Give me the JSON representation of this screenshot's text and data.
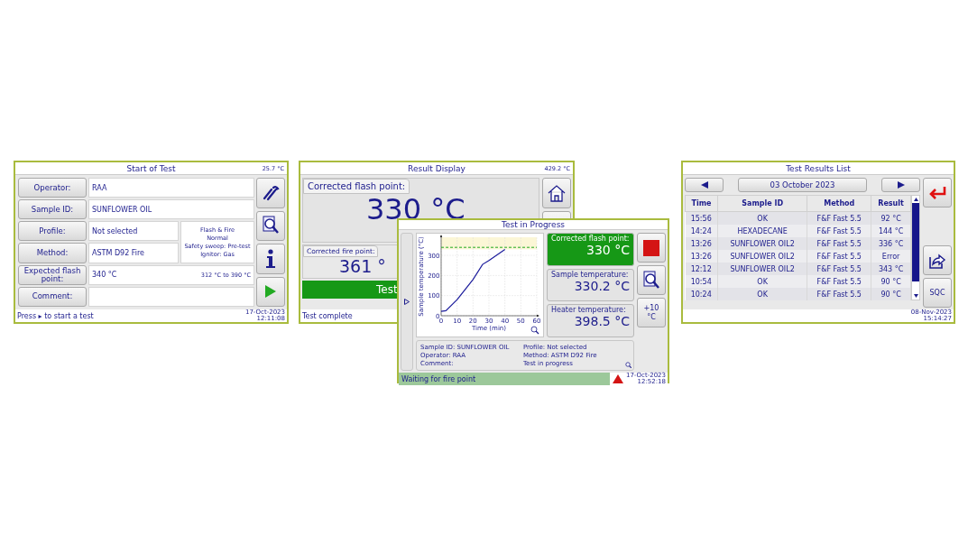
{
  "start_of_test": {
    "title": "Start of Test",
    "temperature": "25.7 °C",
    "fields": [
      {
        "label": "Operator:",
        "value": "RAA",
        "kind": "wide"
      },
      {
        "label": "Sample ID:",
        "value": "SUNFLOWER OIL",
        "kind": "wide"
      },
      {
        "label": "Profile:",
        "value": "Not selected",
        "kind": "narrow"
      },
      {
        "label": "Method:",
        "value": "ASTM D92 Fire",
        "kind": "narrow"
      },
      {
        "label": "Expected flash point:",
        "value": "340 °C",
        "range": "312 °C to 390 °C",
        "kind": "wide"
      },
      {
        "label": "Comment:",
        "kind": "wide"
      }
    ],
    "settings": [
      "Flash & Fire",
      "Normal",
      "Safety sweep: Pre-test",
      "Ignitor: Gas"
    ],
    "status": "Press ▸ to start a test",
    "date": "17-Oct-2023",
    "time": "12:11:08"
  },
  "result_display": {
    "title": "Result Display",
    "temperature": "429.2 °C",
    "flash_label": "Corrected flash point:",
    "flash_value": "330 °C",
    "fire_label": "Corrected fire point:",
    "fire_value": "361 °",
    "banner": "Test",
    "status": "Test complete"
  },
  "test_in_progress": {
    "title": "Test in Progress",
    "chart_data": {
      "type": "line",
      "xlabel": "Time (min)",
      "ylabel": "Sample temperature (°C)",
      "x": [
        0,
        3,
        10,
        20,
        26,
        30,
        40,
        60
      ],
      "series": [
        {
          "color": "#1c1c9c",
          "values": [
            22,
            25,
            80,
            180,
            255,
            275,
            330,
            null
          ]
        },
        {
          "color": "#22aa22",
          "line_style": "dashed",
          "values": [
            340,
            340,
            340,
            340,
            340,
            340,
            340,
            340
          ]
        }
      ],
      "xlim": [
        0,
        60
      ],
      "ylim": [
        0,
        390
      ],
      "xticks": [
        0,
        10,
        20,
        30,
        40,
        50,
        60
      ],
      "yticks": [
        0,
        100,
        200,
        300
      ],
      "grid": true,
      "bands": [
        {
          "from": 330,
          "to": 390,
          "axis": "y",
          "color": "#fbf6d6"
        }
      ]
    },
    "readings": [
      {
        "label": "Corrected flash point:",
        "value": "330 °C",
        "active": true
      },
      {
        "label": "Sample temperature:",
        "value": "330.2 °C",
        "active": false
      },
      {
        "label": "Heater temperature:",
        "value": "398.5 °C",
        "active": false
      }
    ],
    "offset_button": "+10 °C",
    "info_left": [
      "Sample ID: SUNFLOWER OIL",
      "Operator: RAA",
      "Comment:"
    ],
    "info_right": [
      "Profile: Not selected",
      "Method: ASTM D92 Fire",
      "Test in progress"
    ],
    "status": "Waiting for fire point",
    "date": "17-Oct-2023",
    "time": "12:52:18"
  },
  "test_results_list": {
    "title": "Test Results List",
    "date": "03 October 2023",
    "columns": [
      "Time",
      "Sample ID",
      "Method",
      "Result"
    ],
    "rows": [
      {
        "time": "15:56",
        "sample_id": "OK",
        "method": "F&F Fast 5.5",
        "result": "92 °C"
      },
      {
        "time": "14:24",
        "sample_id": "HEXADECANE",
        "method": "F&F Fast 5.5",
        "result": "144 °C"
      },
      {
        "time": "13:26",
        "sample_id": "SUNFLOWER OIL2",
        "method": "F&F Fast 5.5",
        "result": "336 °C"
      },
      {
        "time": "13:26",
        "sample_id": "SUNFLOWER OIL2",
        "method": "F&F Fast 5.5",
        "result": "Error"
      },
      {
        "time": "12:12",
        "sample_id": "SUNFLOWER OIL2",
        "method": "F&F Fast 5.5",
        "result": "343 °C"
      },
      {
        "time": "10:54",
        "sample_id": "OK",
        "method": "F&F Fast 5.5",
        "result": "90 °C"
      },
      {
        "time": "10:24",
        "sample_id": "OK",
        "method": "F&F Fast 5.5",
        "result": "90 °C"
      }
    ],
    "sqc_button": "SQC",
    "footer_date": "08-Nov-2023",
    "footer_time": "15:14:27"
  }
}
